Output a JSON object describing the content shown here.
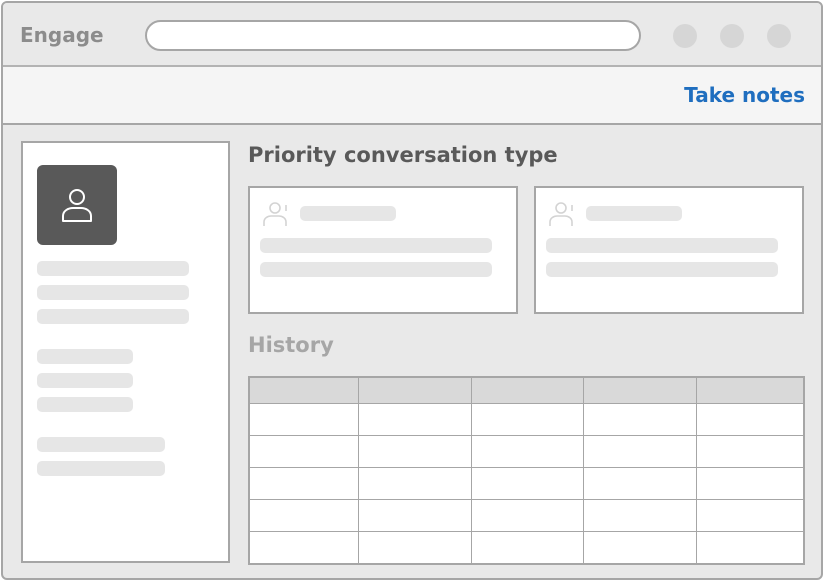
{
  "app": {
    "title": "Engage"
  },
  "address_bar": {
    "value": ""
  },
  "action_bar": {
    "take_notes_label": "Take notes"
  },
  "main": {
    "priority_title": "Priority conversation type",
    "history_title": "History"
  },
  "history_table": {
    "columns": [
      "",
      "",
      "",
      "",
      ""
    ],
    "rows": [
      [
        "",
        "",
        "",
        "",
        ""
      ],
      [
        "",
        "",
        "",
        "",
        ""
      ],
      [
        "",
        "",
        "",
        "",
        ""
      ],
      [
        "",
        "",
        "",
        "",
        ""
      ],
      [
        "",
        "",
        "",
        "",
        ""
      ]
    ]
  },
  "icons": {
    "avatar": "user-icon",
    "card": "user-icon",
    "window_controls": [
      "window-control",
      "window-control",
      "window-control"
    ]
  },
  "colors": {
    "accent_link": "#1f6ebf",
    "avatar_bg": "#595959",
    "chrome_bg": "#e9e9e9",
    "placeholder": "#e6e6e6",
    "border": "#a6a6a6"
  }
}
